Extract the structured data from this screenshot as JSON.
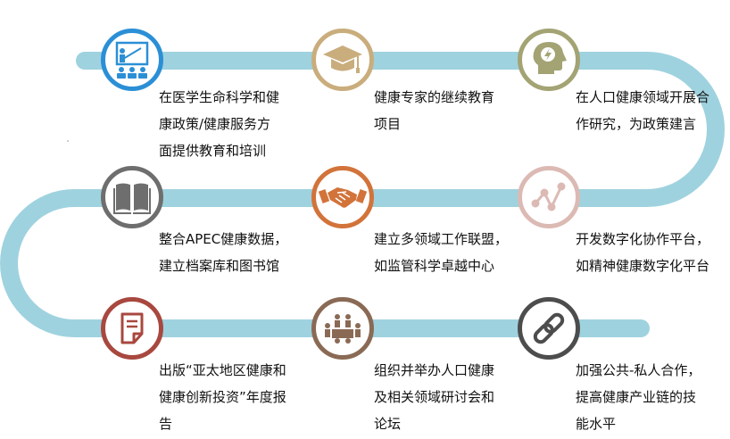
{
  "colors": {
    "track": "#9fd2df",
    "blue": "#2b8fd6",
    "gold": "#c9ad7c",
    "olive": "#a3a374",
    "gray": "#6e6e6e",
    "orange": "#d2733a",
    "pink": "#dcbab4",
    "maroon": "#a8483f",
    "brown": "#8a6a55",
    "dark": "#4d4d4d"
  },
  "steps": [
    {
      "id": 1,
      "icon": "presentation-icon",
      "text": "在医学生命科学和健\n康政策/健康服务方\n面提供教育和培训"
    },
    {
      "id": 2,
      "icon": "graduation-cap-icon",
      "text": "健康专家的继续教育\n项目"
    },
    {
      "id": 3,
      "icon": "head-idea-icon",
      "text": "在人口健康领域开展合\n作研究，为政策建言"
    },
    {
      "id": 4,
      "icon": "open-book-icon",
      "text": "整合APEC健康数据，\n建立档案库和图书馆"
    },
    {
      "id": 5,
      "icon": "handshake-icon",
      "text": "建立多领域工作联盟，\n如监管科学卓越中心"
    },
    {
      "id": 6,
      "icon": "network-graph-icon",
      "text": "开发数字化协作平台，\n如精神健康数字化平台"
    },
    {
      "id": 7,
      "icon": "document-icon",
      "text": "出版“亚太地区健康和\n健康创新投资”年度报\n告"
    },
    {
      "id": 8,
      "icon": "meeting-icon",
      "text": "组织并举办人口健康\n及相关领域研讨会和\n论坛"
    },
    {
      "id": 9,
      "icon": "chain-link-icon",
      "text": "加强公共-私人合作，\n提高健康产业链的技\n能水平"
    }
  ]
}
